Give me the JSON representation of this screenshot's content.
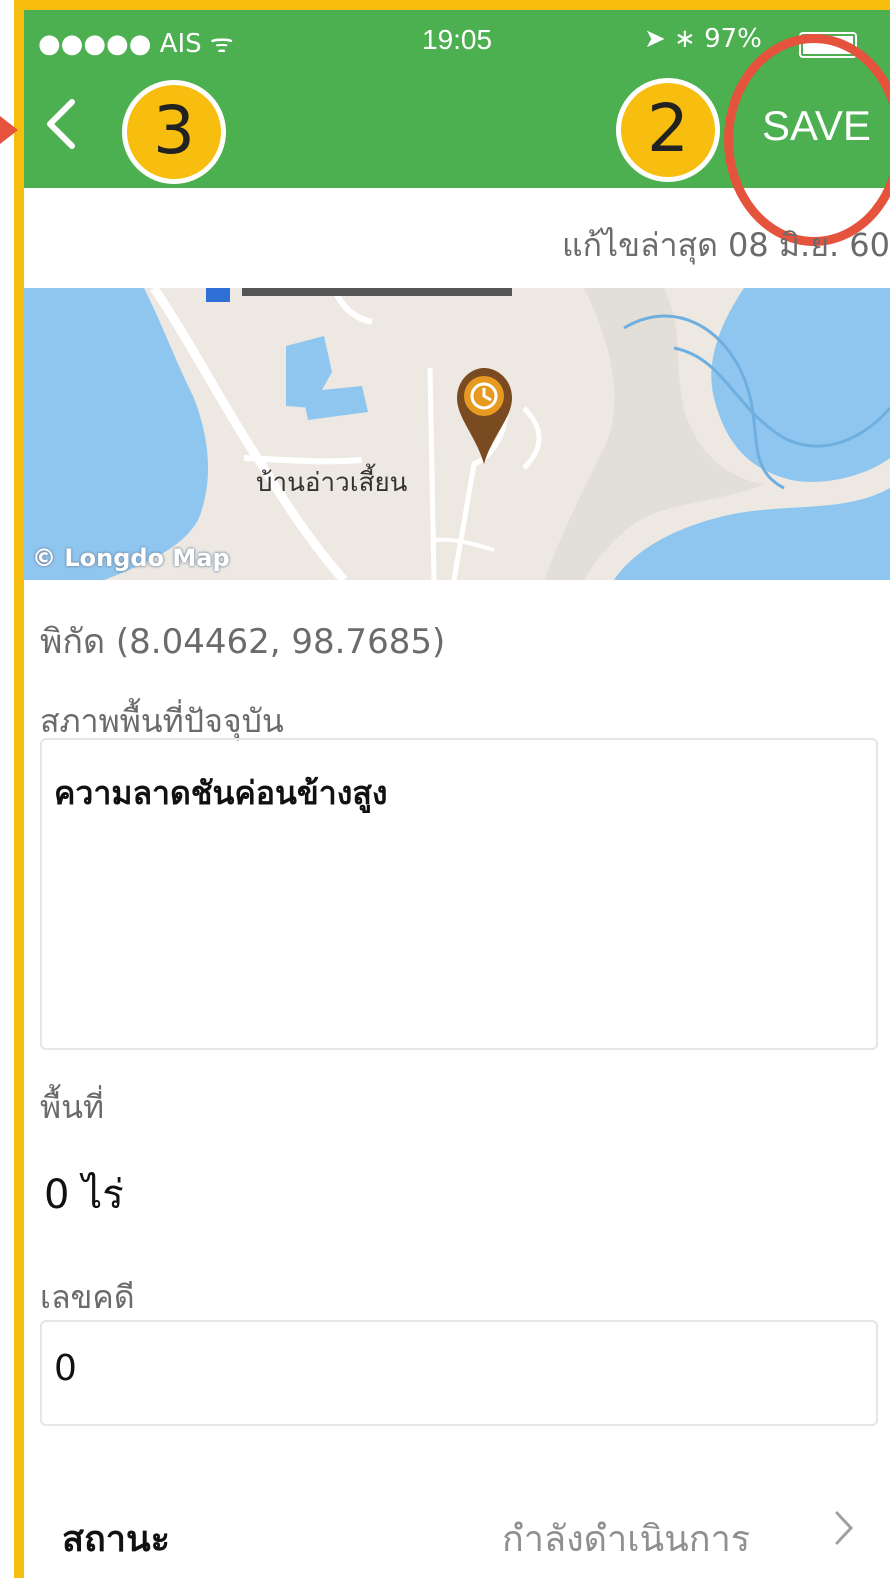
{
  "status_bar": {
    "carrier": "●●●●● AIS ᯤ",
    "time": "19:05",
    "battery_text": "➤ ∗ 97%"
  },
  "nav": {
    "back_icon": "chevron-left-icon",
    "save_label": "SAVE",
    "callout_back": "3",
    "callout_save": "2"
  },
  "last_edited": "แก้ไขล่าสุด 08 มิ.ย. 60",
  "map": {
    "place_label": "บ้านอ่าวเสี้ยน",
    "credit": "© Longdo Map"
  },
  "coordinates": "พิกัด (8.04462, 98.7685)",
  "condition": {
    "label": "สภาพพื้นที่ปัจจุบัน",
    "value": "ความลาดชันค่อนข้างสูง"
  },
  "area": {
    "label": "พื้นที่",
    "value": "0 ไร่"
  },
  "case_number": {
    "label": "เลขคดี",
    "value": "0"
  },
  "status": {
    "label": "สถานะ",
    "value": "กำลังดำเนินการ"
  },
  "colors": {
    "header_green": "#4CAF50",
    "callout_yellow": "#F8BE0F",
    "highlight_red": "#E5533D",
    "map_water": "#8EC6F0",
    "pin_orange": "#E79A21"
  }
}
